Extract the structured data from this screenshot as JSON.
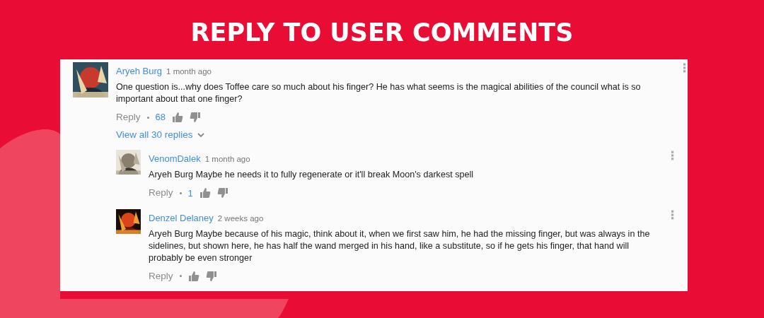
{
  "heading": "REPLY TO USER COMMENTS",
  "comments": [
    {
      "author": "Aryeh Burg",
      "time": "1 month ago",
      "text": "One question is...why does Toffee care so much about his finger? He has what seems is the magical abilities of the council what is so important about that one finger?",
      "reply_label": "Reply",
      "likes": "68",
      "view_replies": "View all 30 replies",
      "replies": [
        {
          "author": "VenomDalek",
          "time": "1 month ago",
          "text": "Aryeh Burg Maybe he needs it to fully regenerate or it'll break Moon's darkest spell",
          "reply_label": "Reply",
          "likes": "1"
        },
        {
          "author": "Denzel Delaney",
          "time": "2 weeks ago",
          "text": "Aryeh Burg Maybe because of his magic, think about it, when we first saw him, he had the missing finger, but was always in the sidelines, but shown here, he has half the wand merged in his hand, like a substitute, so if he gets his finger, that hand will probably be even stronger",
          "reply_label": "Reply"
        }
      ]
    }
  ]
}
